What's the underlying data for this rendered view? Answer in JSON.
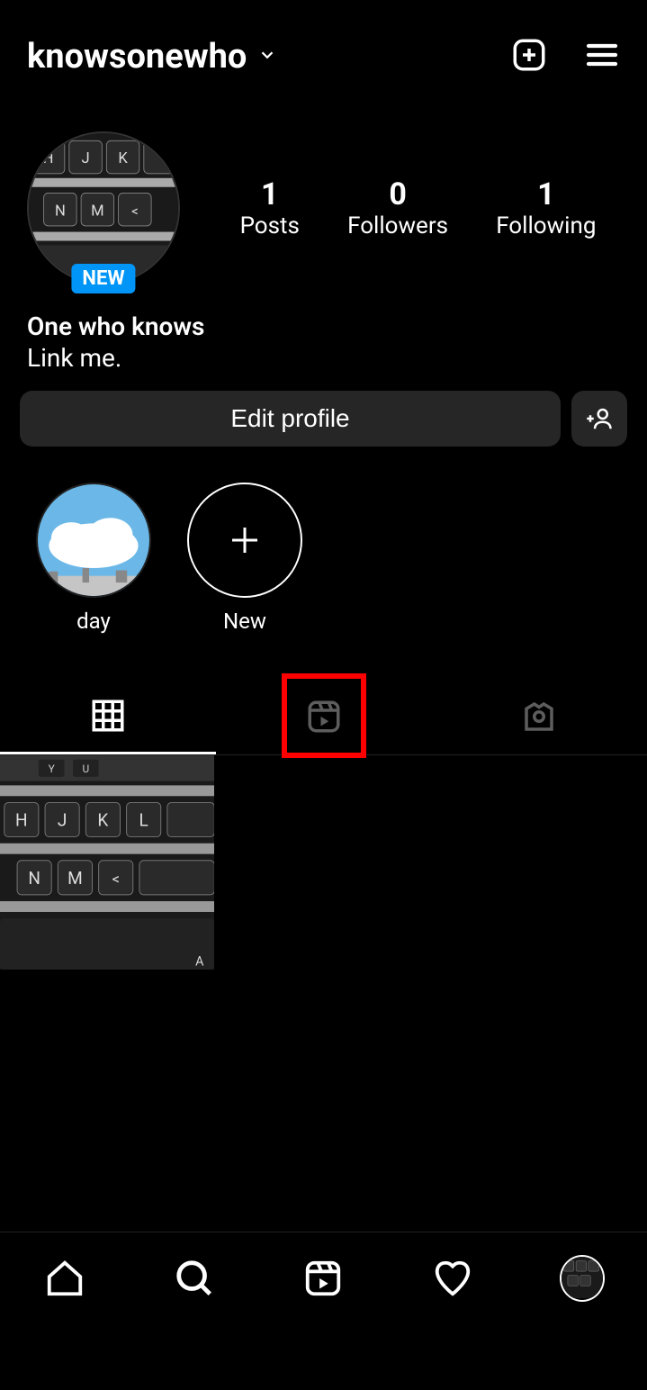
{
  "header": {
    "username": "knowsonewho"
  },
  "profile": {
    "new_badge": "NEW",
    "stats": {
      "posts": {
        "value": "1",
        "label": "Posts"
      },
      "followers": {
        "value": "0",
        "label": "Followers"
      },
      "following": {
        "value": "1",
        "label": "Following"
      }
    },
    "display_name": "One who knows",
    "bio": "Link me.",
    "edit_profile_label": "Edit profile"
  },
  "highlights": [
    {
      "label": "day"
    },
    {
      "label": "New"
    }
  ]
}
